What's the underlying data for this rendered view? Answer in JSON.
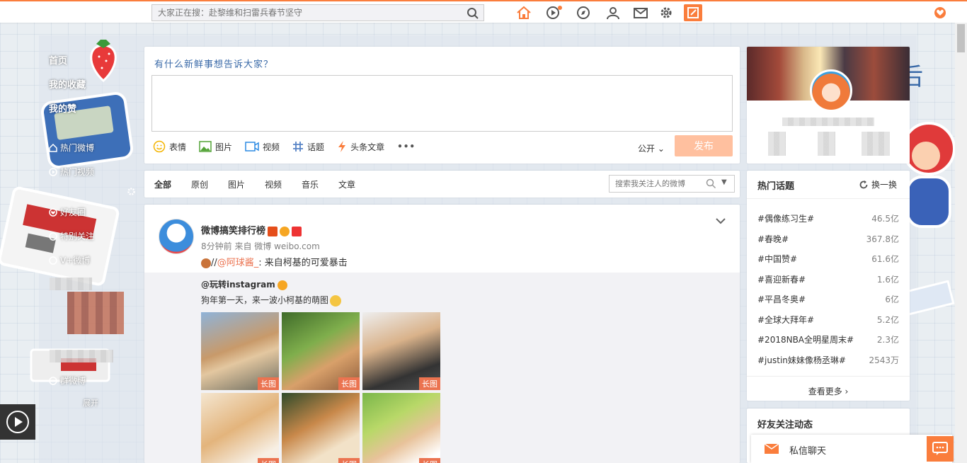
{
  "topbar": {
    "search_placeholder": "大家正在搜：赴黎维和扫雷兵春节坚守",
    "icons": [
      "home-icon",
      "video-icon",
      "discover-icon",
      "profile-icon",
      "mail-icon",
      "settings-icon",
      "compose-icon"
    ],
    "accent": "#fa7d3c"
  },
  "leftnav": {
    "items": [
      {
        "label": "首页"
      },
      {
        "label": "我的收藏"
      },
      {
        "label": "我的赞"
      },
      {
        "label": "热门微博"
      },
      {
        "label": "热门视频"
      },
      {
        "label": "好友圈"
      },
      {
        "label": "特别关注"
      },
      {
        "label": "V+微博"
      },
      {
        "label": "群微博"
      }
    ],
    "expand": "展开"
  },
  "composer": {
    "prompt": "有什么新鲜事想告诉大家？",
    "tools": [
      "表情",
      "图片",
      "视频",
      "话题",
      "头条文章",
      "•••"
    ],
    "privacy": "公开",
    "publish": "发布"
  },
  "tabs": {
    "items": [
      "全部",
      "原创",
      "图片",
      "视频",
      "音乐",
      "文章"
    ],
    "search_placeholder": "搜索我关注人的微博"
  },
  "post": {
    "author": "微博搞笑排行榜",
    "meta": "8分钟前 来自 微博 weibo.com",
    "repost_prefix": "//",
    "mention": "@阿球酱_",
    "repost_suffix": ": 来自柯基的可爱暴击",
    "quoted_author": "@玩转instagram",
    "quoted_text": "狗年第一天，来一波小柯基的萌图",
    "thumb_tag": "长图"
  },
  "hot_topics": {
    "title": "热门话题",
    "refresh": "换一换",
    "items": [
      {
        "name": "#偶像练习生#",
        "count": "46.5亿"
      },
      {
        "name": "#春晚#",
        "count": "367.8亿"
      },
      {
        "name": "#中国赞#",
        "count": "61.6亿"
      },
      {
        "name": "#喜迎新春#",
        "count": "1.6亿"
      },
      {
        "name": "#平昌冬奥#",
        "count": "6亿"
      },
      {
        "name": "#全球大拜年#",
        "count": "5.2亿"
      },
      {
        "name": "#2018NBA全明星周末#",
        "count": "2.3亿"
      },
      {
        "name": "#justin妹妹像杨丞琳#",
        "count": "2543万"
      }
    ],
    "see_more": "查看更多 ›"
  },
  "friends": {
    "title": "好友关注动态"
  },
  "chat": {
    "label": "私信聊天"
  }
}
